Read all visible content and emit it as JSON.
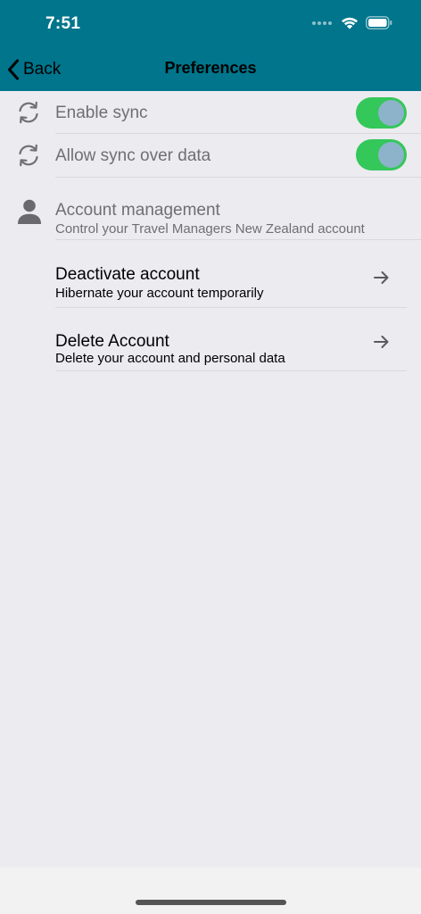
{
  "status_bar": {
    "time": "7:51"
  },
  "nav": {
    "back_label": "Back",
    "title": "Preferences"
  },
  "settings": {
    "enable_sync": {
      "label": "Enable sync",
      "on": true
    },
    "allow_sync_data": {
      "label": "Allow sync over data",
      "on": true
    }
  },
  "account": {
    "title": "Account management",
    "subtitle": "Control your Travel Managers New Zealand account",
    "items": [
      {
        "title": "Deactivate account",
        "subtitle": "Hibernate your account temporarily"
      },
      {
        "title": "Delete Account",
        "subtitle": "Delete your account and personal data"
      }
    ]
  },
  "colors": {
    "header": "#00758c",
    "toggle_on": "#34c759",
    "background": "#ebebf0"
  }
}
